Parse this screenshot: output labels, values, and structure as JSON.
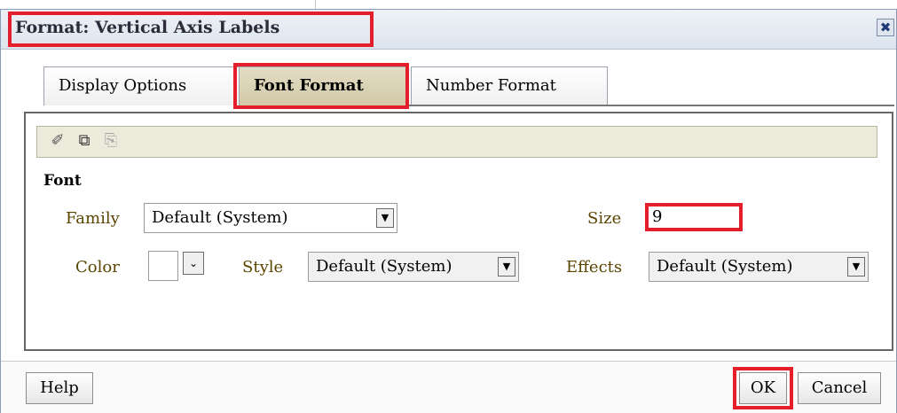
{
  "dialog": {
    "title": "Format: Vertical Axis Labels",
    "close_icon": "✖"
  },
  "tabs": [
    {
      "label": "Display Options",
      "active": false
    },
    {
      "label": "Font Format",
      "active": true
    },
    {
      "label": "Number Format",
      "active": false
    }
  ],
  "toolbar": {
    "icons": [
      "eraser-icon",
      "copy-icon",
      "paste-icon"
    ],
    "eraser_glyph": "✐",
    "copy_glyph": "⧉",
    "paste_glyph": "⎘"
  },
  "font": {
    "section_label": "Font",
    "family_label": "Family",
    "family_value": "Default (System)",
    "size_label": "Size",
    "size_value": "9",
    "color_label": "Color",
    "style_label": "Style",
    "style_value": "Default (System)",
    "effects_label": "Effects",
    "effects_value": "Default (System)"
  },
  "buttons": {
    "help": "Help",
    "ok": "OK",
    "cancel": "Cancel"
  },
  "colors": {
    "highlight": "#e41e2b",
    "active_tab": "#d2c9a8"
  }
}
